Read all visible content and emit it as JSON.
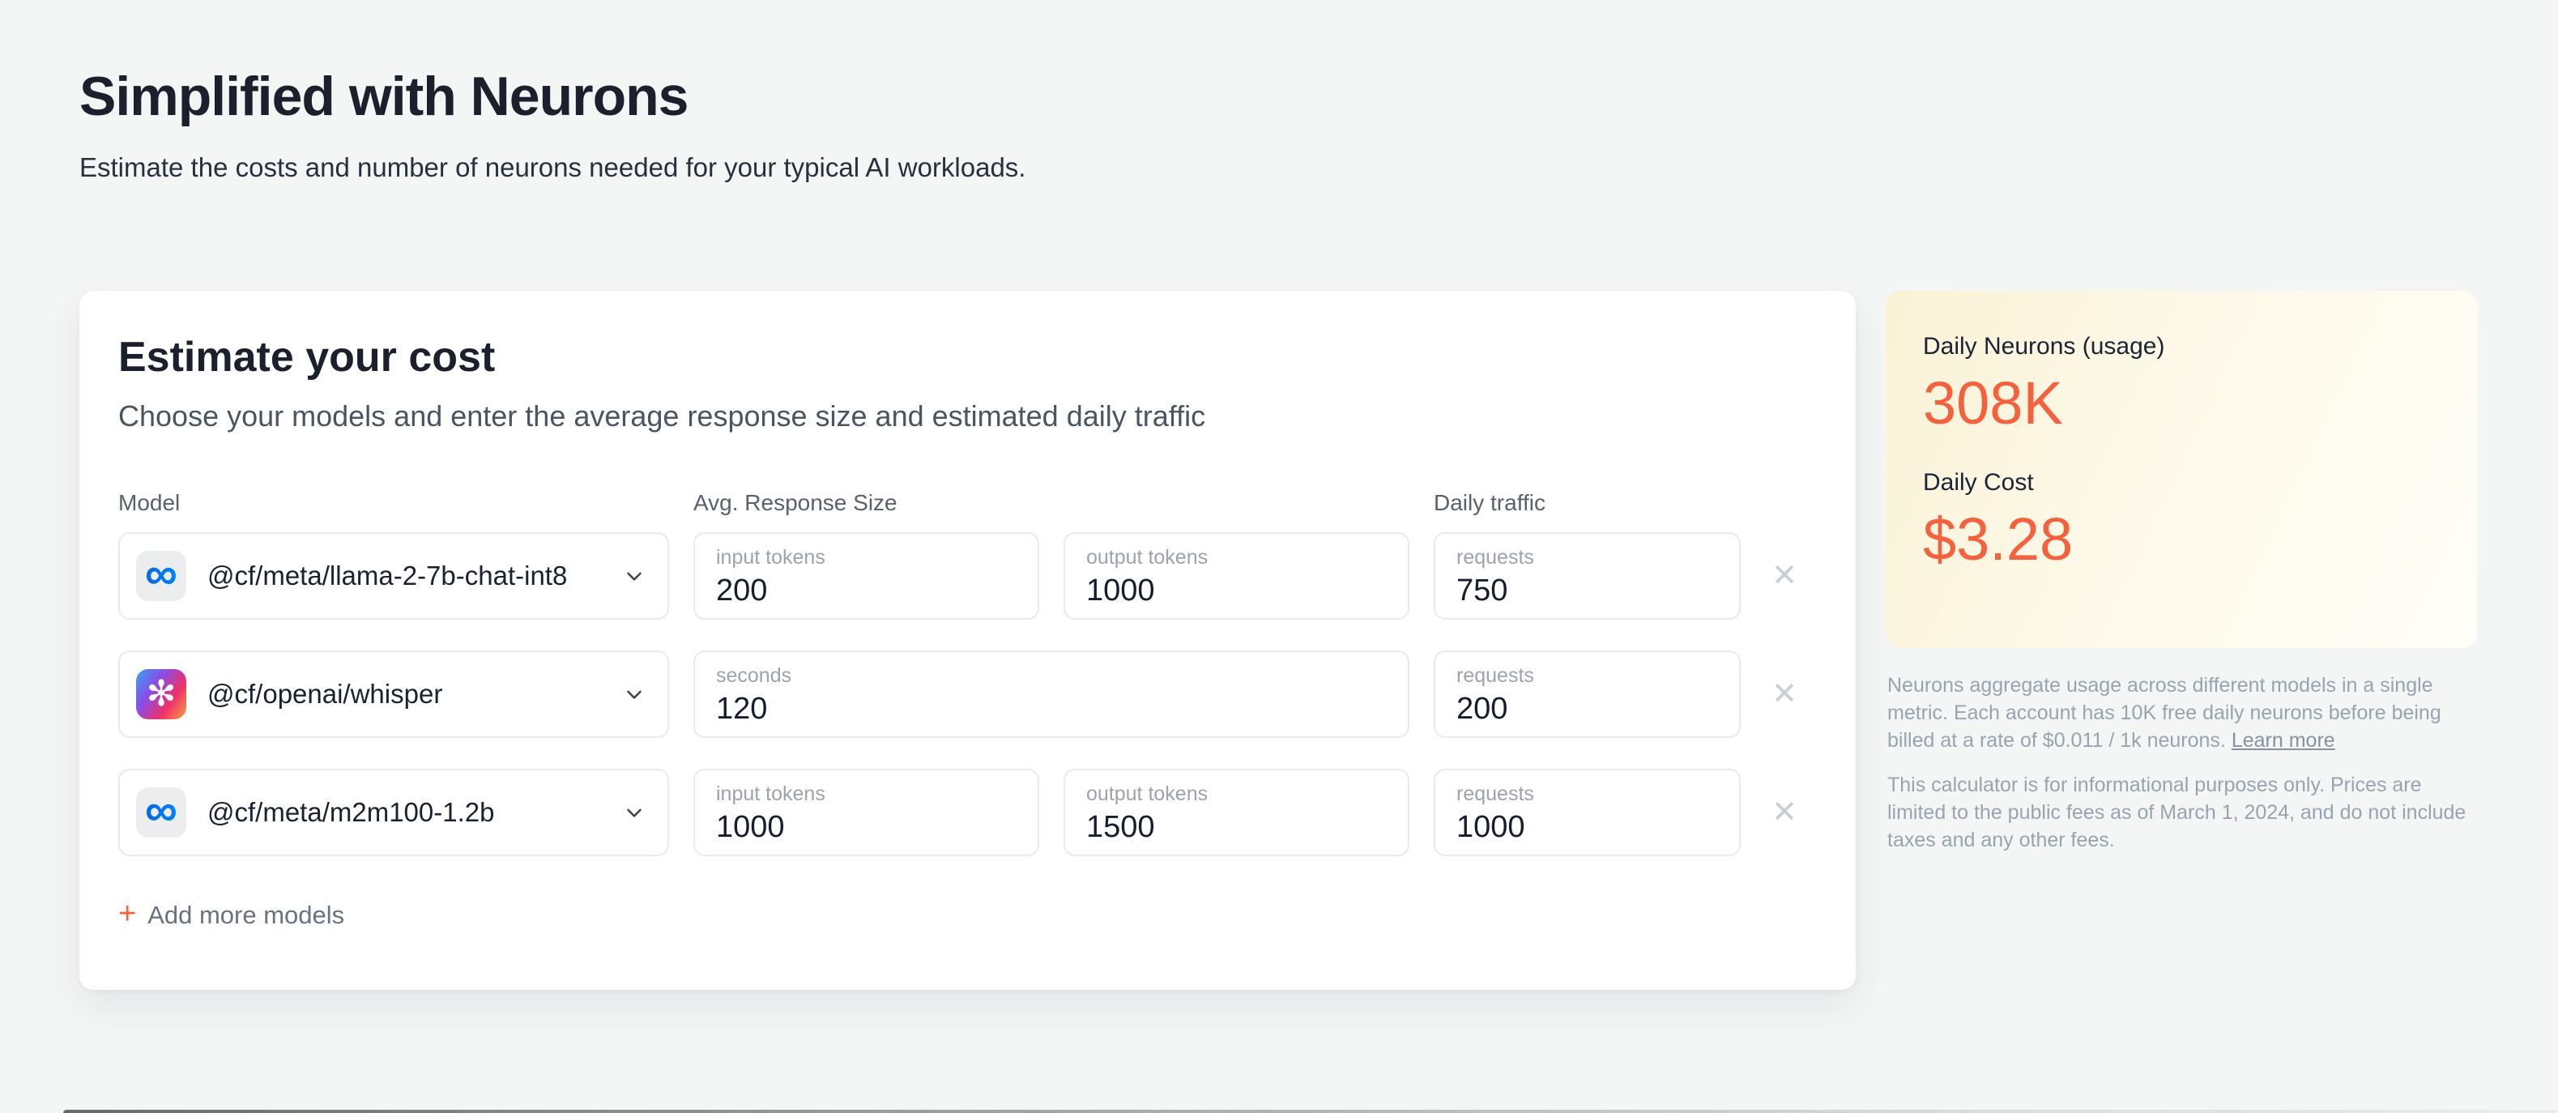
{
  "page": {
    "title": "Simplified with Neurons",
    "subtitle": "Estimate the costs and number of neurons needed for your typical AI workloads."
  },
  "calculator": {
    "heading": "Estimate your cost",
    "subheading": "Choose your models and enter the average response size and estimated daily traffic",
    "columns": {
      "model": "Model",
      "response_size": "Avg. Response Size",
      "daily_traffic": "Daily traffic"
    },
    "rows": [
      {
        "model": "@cf/meta/llama-2-7b-chat-int8",
        "icon": "meta-logo",
        "fields": [
          {
            "label": "input tokens",
            "value": "200"
          },
          {
            "label": "output tokens",
            "value": "1000"
          }
        ],
        "traffic": {
          "label": "requests",
          "value": "750"
        }
      },
      {
        "model": "@cf/openai/whisper",
        "icon": "openai-logo",
        "fields": [
          {
            "label": "seconds",
            "value": "120"
          }
        ],
        "traffic": {
          "label": "requests",
          "value": "200"
        }
      },
      {
        "model": "@cf/meta/m2m100-1.2b",
        "icon": "meta-logo",
        "fields": [
          {
            "label": "input tokens",
            "value": "1000"
          },
          {
            "label": "output tokens",
            "value": "1500"
          }
        ],
        "traffic": {
          "label": "requests",
          "value": "1000"
        }
      }
    ],
    "add_more_label": "Add more models"
  },
  "summary": {
    "neurons_label": "Daily Neurons (usage)",
    "neurons_value": "308K",
    "cost_label": "Daily Cost",
    "cost_value": "$3.28"
  },
  "notes": {
    "p1": "Neurons aggregate usage across different models in a single metric. Each account has 10K free daily neurons before being billed at a rate of $0.011 / 1k neurons. ",
    "p1_link": "Learn more",
    "p2": "This calculator is for informational purposes only. Prices are limited to the public fees as of March 1, 2024, and do not include taxes and any other fees."
  },
  "icons": {
    "meta_glyph": "∞",
    "openai_glyph": "✻",
    "remove_glyph": "✕",
    "plus_glyph": "+"
  },
  "colors": {
    "accent_orange": "#F5603D",
    "meta_blue": "#0668E1"
  }
}
